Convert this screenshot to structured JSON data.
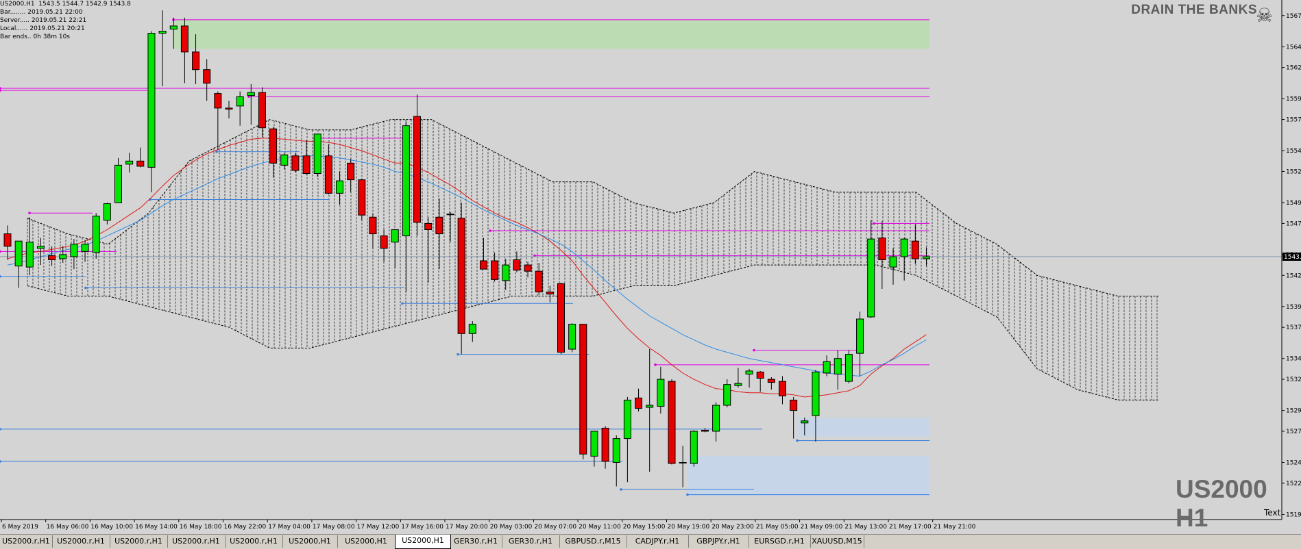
{
  "info": {
    "symbol_line": "US2000,H1  1543.5 1544.7 1542.9 1543.8",
    "bar": "Bar........ 2019.05.21 22:00",
    "server": "Server..... 2019.05.21 22:21",
    "local": "Local...... 2019.05.21 20:21",
    "bar_ends": "Bar ends.. 0h 38m 10s"
  },
  "watermark": "DRAIN THE BANKS",
  "symbol_title": "US2000 H1",
  "text_label": "Text",
  "current_price_label": "1543.",
  "chart_data": {
    "type": "candlestick",
    "symbol": "US2000",
    "timeframe": "H1",
    "ylim": [
      1518.5,
      1568.5
    ],
    "y_ticks": [
      1567.0,
      1564.0,
      1562.0,
      1559.0,
      1557.0,
      1554.0,
      1552.0,
      1549.0,
      1547.0,
      1544.0,
      1542.0,
      1539.0,
      1537.0,
      1534.0,
      1532.0,
      1529.0,
      1527.0,
      1524.0,
      1522.0,
      1519.0
    ],
    "y_tick_labels": [
      "1567.",
      "1564.",
      "1562.",
      "1559.",
      "1557.",
      "1554.",
      "1552.",
      "1549.",
      "1547.",
      "1544.",
      "1542.",
      "1539.",
      "1537.",
      "1534.",
      "1532.",
      "1529.",
      "1527.",
      "1524.",
      "1522.",
      "1519."
    ],
    "x_tick_labels": [
      "6 May 2019",
      "16 May 06:00",
      "16 May 10:00",
      "16 May 14:00",
      "16 May 18:00",
      "16 May 22:00",
      "17 May 04:00",
      "17 May 08:00",
      "17 May 12:00",
      "17 May 16:00",
      "17 May 20:00",
      "20 May 03:00",
      "20 May 07:00",
      "20 May 11:00",
      "20 May 15:00",
      "20 May 19:00",
      "20 May 23:00",
      "21 May 05:00",
      "21 May 09:00",
      "21 May 13:00",
      "21 May 17:00",
      "21 May 21:00"
    ],
    "current_price": 1543.8,
    "candles": [
      [
        1546.0,
        1546.8,
        1543.5,
        1544.8
      ],
      [
        1542.9,
        1545.0,
        1540.8,
        1545.3
      ],
      [
        1542.8,
        1547.6,
        1542.0,
        1545.2
      ],
      [
        1544.6,
        1545.6,
        1543.0,
        1544.8
      ],
      [
        1543.9,
        1544.8,
        1542.9,
        1543.5
      ],
      [
        1543.6,
        1544.8,
        1543.2,
        1544.0
      ],
      [
        1543.8,
        1545.5,
        1542.6,
        1545.0
      ],
      [
        1544.3,
        1545.4,
        1543.3,
        1545.0
      ],
      [
        1544.2,
        1548.0,
        1543.6,
        1547.7
      ],
      [
        1547.3,
        1549.0,
        1546.9,
        1548.9
      ],
      [
        1549.0,
        1553.3,
        1549.0,
        1552.6
      ],
      [
        1552.7,
        1553.8,
        1551.9,
        1553.0
      ],
      [
        1553.0,
        1554.3,
        1552.4,
        1552.5
      ],
      [
        1552.4,
        1565.5,
        1550.0,
        1565.3
      ],
      [
        1565.3,
        1567.5,
        1560.2,
        1565.5
      ],
      [
        1565.7,
        1566.8,
        1563.8,
        1566.0
      ],
      [
        1566.0,
        1566.8,
        1560.5,
        1563.5
      ],
      [
        1563.5,
        1565.2,
        1560.4,
        1561.8
      ],
      [
        1561.8,
        1562.8,
        1558.8,
        1560.5
      ],
      [
        1559.5,
        1559.7,
        1554.1,
        1558.1
      ],
      [
        1558.1,
        1558.8,
        1557.1,
        1558.0
      ],
      [
        1558.3,
        1559.7,
        1556.4,
        1559.2
      ],
      [
        1559.3,
        1560.4,
        1556.5,
        1559.6
      ],
      [
        1559.6,
        1560.1,
        1555.3,
        1556.2
      ],
      [
        1556.1,
        1556.3,
        1551.4,
        1552.8
      ],
      [
        1552.6,
        1553.8,
        1552.2,
        1553.6
      ],
      [
        1553.5,
        1553.8,
        1551.9,
        1552.1
      ],
      [
        1553.5,
        1555.0,
        1551.7,
        1551.8
      ],
      [
        1551.8,
        1555.6,
        1551.5,
        1555.6
      ],
      [
        1553.5,
        1554.6,
        1549.8,
        1549.9
      ],
      [
        1549.9,
        1552.0,
        1548.8,
        1551.1
      ],
      [
        1552.8,
        1553.2,
        1550.0,
        1551.2
      ],
      [
        1551.2,
        1551.3,
        1547.3,
        1547.8
      ],
      [
        1547.6,
        1548.0,
        1544.6,
        1546.0
      ],
      [
        1545.8,
        1546.4,
        1543.3,
        1544.6
      ],
      [
        1545.2,
        1546.4,
        1542.7,
        1546.4
      ],
      [
        1545.8,
        1556.8,
        1540.4,
        1556.4
      ],
      [
        1557.3,
        1559.4,
        1545.8,
        1547.1
      ],
      [
        1547.0,
        1547.6,
        1541.3,
        1546.4
      ],
      [
        1547.6,
        1549.4,
        1542.6,
        1546.0
      ],
      [
        1547.9,
        1548.1,
        1545.2,
        1547.9
      ],
      [
        1547.5,
        1549.0,
        1534.4,
        1536.4
      ],
      [
        1536.4,
        1537.6,
        1535.6,
        1537.3
      ],
      [
        1543.4,
        1545.6,
        1542.6,
        1542.6
      ],
      [
        1543.4,
        1544.2,
        1541.4,
        1541.6
      ],
      [
        1541.5,
        1543.6,
        1540.6,
        1543.0
      ],
      [
        1543.5,
        1544.3,
        1542.3,
        1542.5
      ],
      [
        1543.0,
        1543.3,
        1541.8,
        1542.4
      ],
      [
        1542.4,
        1543.2,
        1540.1,
        1540.4
      ],
      [
        1540.4,
        1541.0,
        1539.4,
        1540.2
      ],
      [
        1541.2,
        1541.3,
        1534.4,
        1534.6
      ],
      [
        1534.9,
        1537.4,
        1534.6,
        1537.3
      ],
      [
        1537.3,
        1537.3,
        1524.3,
        1524.8
      ],
      [
        1524.6,
        1526.9,
        1523.6,
        1527.0
      ],
      [
        1527.3,
        1527.5,
        1523.4,
        1524.1
      ],
      [
        1524.0,
        1526.6,
        1521.7,
        1526.3
      ],
      [
        1526.3,
        1530.3,
        1522.1,
        1530.0
      ],
      [
        1530.2,
        1531.1,
        1528.9,
        1529.2
      ],
      [
        1529.3,
        1534.9,
        1523.1,
        1529.5
      ],
      [
        1529.4,
        1533.2,
        1528.7,
        1532.0
      ],
      [
        1531.8,
        1532.0,
        1523.8,
        1523.9
      ],
      [
        1524.0,
        1525.6,
        1521.6,
        1524.0
      ],
      [
        1523.9,
        1527.1,
        1523.6,
        1527.0
      ],
      [
        1527.1,
        1527.3,
        1526.9,
        1527.0
      ],
      [
        1527.0,
        1529.8,
        1526.0,
        1529.5
      ],
      [
        1529.5,
        1532.0,
        1529.3,
        1531.5
      ],
      [
        1531.4,
        1533.1,
        1531.2,
        1531.6
      ],
      [
        1532.5,
        1533.0,
        1531.2,
        1532.8
      ],
      [
        1532.7,
        1532.8,
        1530.8,
        1532.1
      ],
      [
        1532.0,
        1532.2,
        1531.0,
        1531.7
      ],
      [
        1531.8,
        1532.3,
        1529.6,
        1530.4
      ],
      [
        1530.0,
        1530.3,
        1526.3,
        1529.0
      ],
      [
        1527.8,
        1528.3,
        1526.6,
        1528.0
      ],
      [
        1528.5,
        1532.9,
        1526.0,
        1532.7
      ],
      [
        1532.6,
        1534.3,
        1532.3,
        1533.7
      ],
      [
        1532.5,
        1534.8,
        1531.0,
        1534.0
      ],
      [
        1531.8,
        1534.8,
        1531.6,
        1534.4
      ],
      [
        1534.5,
        1538.5,
        1532.3,
        1537.8
      ],
      [
        1538.0,
        1547.3,
        1537.9,
        1545.5
      ],
      [
        1545.6,
        1547.2,
        1540.7,
        1543.5
      ],
      [
        1542.8,
        1544.6,
        1541.1,
        1543.8
      ],
      [
        1543.8,
        1545.6,
        1541.5,
        1545.5
      ],
      [
        1545.3,
        1546.9,
        1543.1,
        1543.6
      ],
      [
        1543.6,
        1544.7,
        1542.9,
        1543.8
      ]
    ],
    "sma_red": [
      1543.6,
      1543.9,
      1544.2,
      1544.3,
      1544.5,
      1544.7,
      1544.9,
      1545.3,
      1545.8,
      1546.4,
      1547.1,
      1547.8,
      1548.5,
      1549.5,
      1550.6,
      1551.6,
      1552.4,
      1553.1,
      1553.7,
      1554.1,
      1554.5,
      1554.8,
      1555.1,
      1555.2,
      1555.2,
      1555.1,
      1555.0,
      1554.9,
      1554.9,
      1554.8,
      1554.6,
      1554.3,
      1554.0,
      1553.6,
      1553.2,
      1552.8,
      1552.8,
      1552.4,
      1551.9,
      1551.3,
      1550.7,
      1550.0,
      1549.2,
      1548.6,
      1548.0,
      1547.5,
      1547.1,
      1546.6,
      1546.0,
      1545.3,
      1544.4,
      1543.4,
      1542.0,
      1540.7,
      1539.4,
      1538.1,
      1536.9,
      1535.9,
      1535.0,
      1534.3,
      1533.4,
      1532.6,
      1532.0,
      1531.5,
      1531.1,
      1531.0,
      1530.8,
      1530.7,
      1530.7,
      1530.6,
      1530.6,
      1530.5,
      1530.3,
      1530.4,
      1530.5,
      1530.7,
      1530.9,
      1531.4,
      1532.5,
      1533.3,
      1534.0,
      1534.9,
      1535.6,
      1536.3
    ],
    "sma_blue": [
      1543.0,
      1543.2,
      1543.5,
      1543.8,
      1544.1,
      1544.4,
      1544.6,
      1544.9,
      1545.3,
      1545.8,
      1546.3,
      1546.8,
      1547.3,
      1548.0,
      1548.7,
      1549.3,
      1549.8,
      1550.3,
      1550.8,
      1551.3,
      1551.7,
      1552.1,
      1552.5,
      1552.8,
      1553.1,
      1553.3,
      1553.4,
      1553.5,
      1553.5,
      1553.4,
      1553.3,
      1553.1,
      1552.9,
      1552.7,
      1552.4,
      1552.0,
      1551.8,
      1551.4,
      1551.0,
      1550.5,
      1550.0,
      1549.5,
      1548.9,
      1548.3,
      1547.8,
      1547.3,
      1546.8,
      1546.4,
      1546.0,
      1545.5,
      1545.0,
      1544.3,
      1543.4,
      1542.5,
      1541.5,
      1540.6,
      1539.7,
      1538.9,
      1538.1,
      1537.5,
      1536.9,
      1536.3,
      1535.8,
      1535.3,
      1534.9,
      1534.6,
      1534.3,
      1534.0,
      1533.8,
      1533.6,
      1533.4,
      1533.2,
      1533.0,
      1532.8,
      1532.6,
      1532.5,
      1532.4,
      1532.3,
      1532.8,
      1533.4,
      1533.9,
      1534.5,
      1535.2,
      1535.8
    ],
    "supply_zone": [
      1563.8,
      1566.6
    ],
    "demand_zones": [
      [
        1520.8,
        1524.6
      ],
      [
        1526.5,
        1528.3
      ]
    ],
    "resistance_lines": [
      1566.6,
      1560.0,
      1559.2,
      1547.0,
      1546.3,
      1543.9,
      1559.8,
      1555.2,
      1548.0,
      1544.3,
      1533.4,
      1534.8
    ],
    "support_lines": [
      1553.9,
      1549.3,
      1540.8,
      1541.9,
      1539.3,
      1534.4,
      1527.2,
      1524.1,
      1526.1,
      1521.4,
      1520.9
    ]
  },
  "tabs": [
    "US2000.r,H1",
    "US2000.r,H1",
    "US2000.r,H1",
    "US2000.r,H1",
    "US2000.r,H1",
    "US2000,H1",
    "US2000,H1",
    "US2000,H1",
    "GER30.r,H1",
    "GER30.r,H1",
    "GBPUSD.r,M15",
    "CADJPY.r,H1",
    "GBPJPY.r,H1",
    "EURSGD.r,H1",
    "XAUUSD,M15"
  ],
  "active_tab_index": 7
}
